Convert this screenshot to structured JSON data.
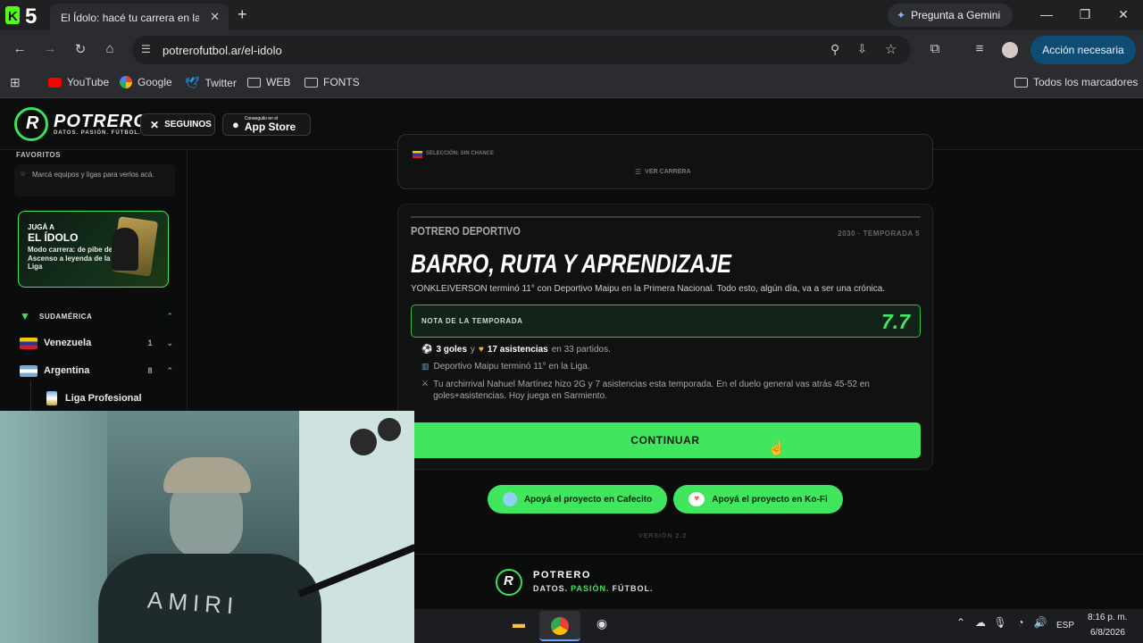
{
  "browser": {
    "tab_title": "El Ídolo: hacé tu carrera en la Liga",
    "new_tab": "+",
    "gemini_label": "Pregunta a Gemini",
    "url": "potrerofutbol.ar/el-idolo",
    "action_label": "Acción necesaria",
    "bookmarks": [
      "YouTube",
      "Google",
      "Twitter",
      "WEB",
      "FONTS"
    ],
    "all_bookmarks": "Todos los marcadores"
  },
  "site": {
    "brand": "POTRERO",
    "tagline": "DATOS. PASIÓN. FÚTBOL.",
    "follow_label": "SEGUINOS",
    "appstore_small": "Conseguilo en el",
    "appstore_label": "App Store"
  },
  "sidebar": {
    "favorites_title": "FAVORITOS",
    "favorites_hint": "Marcá equipos y ligas para verlos acá.",
    "promo_line1": "JUGÁ A",
    "promo_line2": "EL ÍDOLO",
    "promo_desc": "Modo carrera: de pibe del Ascenso a leyenda de la Liga",
    "region": "SUDAMÉRICA",
    "countries": [
      {
        "name": "Venezuela",
        "count": "1"
      },
      {
        "name": "Argentina",
        "count": "8"
      }
    ],
    "league": "Liga Profesional"
  },
  "prev_card": {
    "selection": "SELECCIÓN: SIN CHANCE",
    "view_career": "VER CARRERA"
  },
  "season_card": {
    "kicker": "POTRERO DEPORTIVO",
    "meta": "2030 · TEMPORADA 5",
    "headline": "BARRO, RUTA Y APRENDIZAJE",
    "subtitle": "YONKLEIVERSON terminó 11° con Deportivo Maipu en la Primera Nacional. Todo esto, algún día, va a ser una crónica.",
    "rating_label": "NOTA DE LA TEMPORADA",
    "rating_value": "7.7",
    "goals": "3 goles",
    "y": "y",
    "assists": "17 asistencias",
    "matches": "en 33 partidos.",
    "finish": "Deportivo Maipu terminó 11° en la Liga.",
    "rival": "Tu archirrival Nahuel Martínez hizo 2G y 7 asistencias esta temporada. En el duelo general vas atrás 45-52 en goles+asistencias. Hoy juega en Sarmiento.",
    "continue": "CONTINUAR"
  },
  "support": {
    "cafecito": "Apoyá el proyecto en Cafecito",
    "kofi": "Apoyá el proyecto en Ko-Fi",
    "version": "VERSIÓN 2.2"
  },
  "footer": {
    "brand": "POTRERO",
    "tagline_a": "DATOS.",
    "tagline_b": "PASIÓN.",
    "tagline_c": "FÚTBOL."
  },
  "taskbar": {
    "lang": "ESP",
    "time": "8:16 p. m.",
    "date": "6/8/2026"
  },
  "colors": {
    "accent": "#3fe65e",
    "background": "#0b0d0c"
  }
}
